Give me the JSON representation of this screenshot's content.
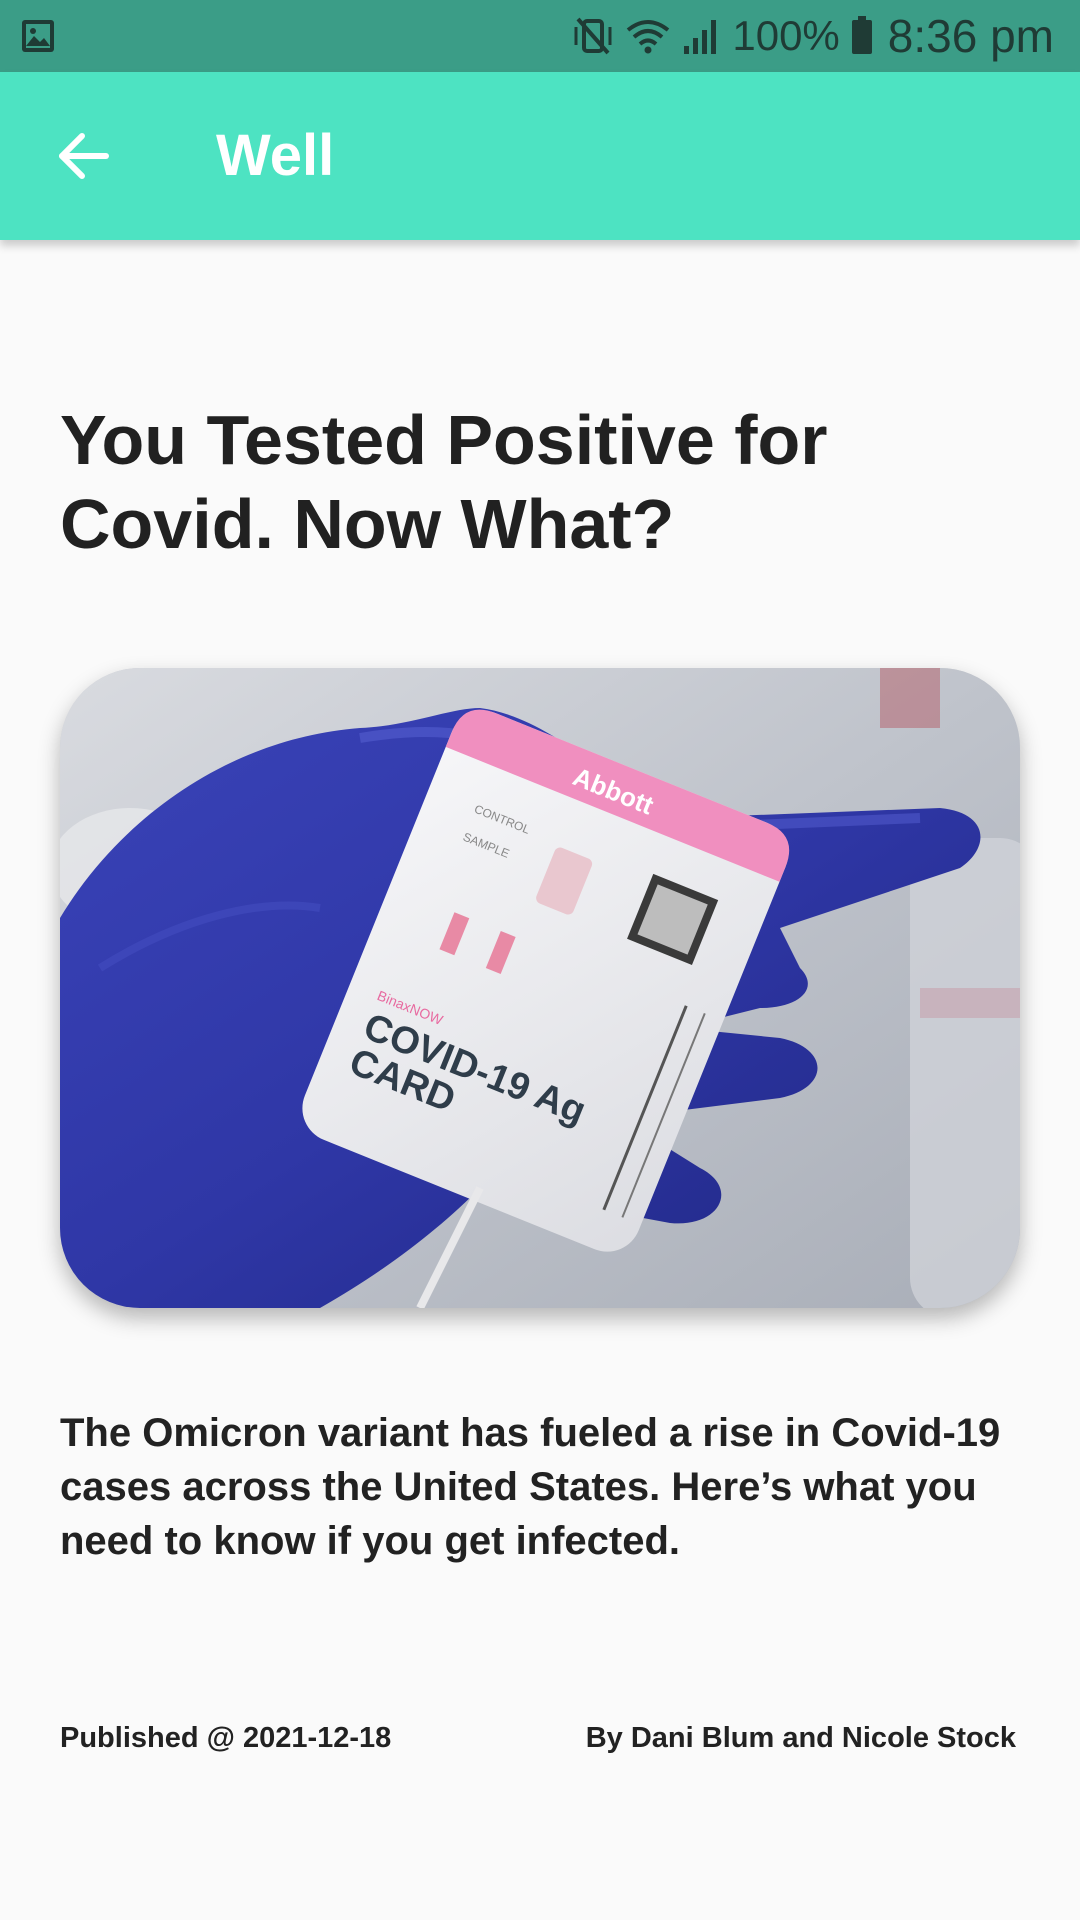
{
  "status_bar": {
    "battery_percent": "100%",
    "time": "8:36 pm",
    "icons": [
      "gallery-notification-icon",
      "mute-vibrate-icon",
      "wifi-icon",
      "signal-icon",
      "battery-icon"
    ]
  },
  "app_bar": {
    "back_icon": "arrow-left-icon",
    "title": "Well"
  },
  "article": {
    "title": "You Tested Positive for Covid. Now What?",
    "image_alt": "Gloved hand holding a COVID-19 rapid antigen test card",
    "image_text": {
      "brand": "Abbott",
      "product_small": "BinaxNOW",
      "product_line1": "COVID-19 Ag",
      "product_line2": "CARD",
      "control": "CONTROL",
      "sample": "SAMPLE"
    },
    "summary": "The Omicron variant has fueled a rise in Covid-19 cases across the United States. Here’s what you need to know if you get infected.",
    "published": "Published @ 2021-12-18",
    "authors": "By Dani Blum and Nicole Stock"
  },
  "colors": {
    "status_bar": "#3b9d87",
    "app_bar": "#4de3c2",
    "background": "#fafafa",
    "text": "#212121"
  }
}
